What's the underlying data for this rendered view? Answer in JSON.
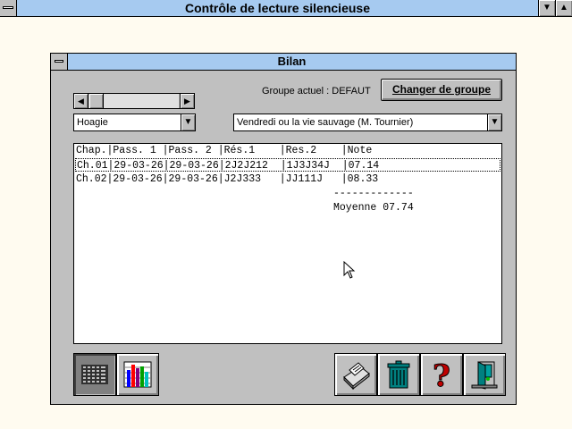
{
  "app": {
    "title": "Contrôle de lecture silencieuse"
  },
  "dialog": {
    "title": "Bilan",
    "group_label": "Groupe actuel : DEFAUT",
    "change_group_button": "Changer de groupe",
    "student_combo": {
      "selected": "Hoagie"
    },
    "book_combo": {
      "selected": "Vendredi ou la vie sauvage (M. Tournier)"
    },
    "results": {
      "header": "Chap.|Pass. 1 |Pass. 2 |Rés.1    |Res.2    |Note",
      "rows": [
        "Ch.01|29-03-26|29-03-26|2J2J212  |1J3J34J  |07.14",
        "Ch.02|29-03-26|29-03-26|J2J333   |JJ111J   |08.33"
      ],
      "separator": "-------------",
      "average": "Moyenne 07.74"
    },
    "buttons": {
      "view_list": "list-view-icon",
      "view_chart": "bar-chart-icon",
      "print": "printer-icon",
      "delete": "trash-icon",
      "help": "help-icon",
      "exit": "exit-door-icon"
    }
  }
}
